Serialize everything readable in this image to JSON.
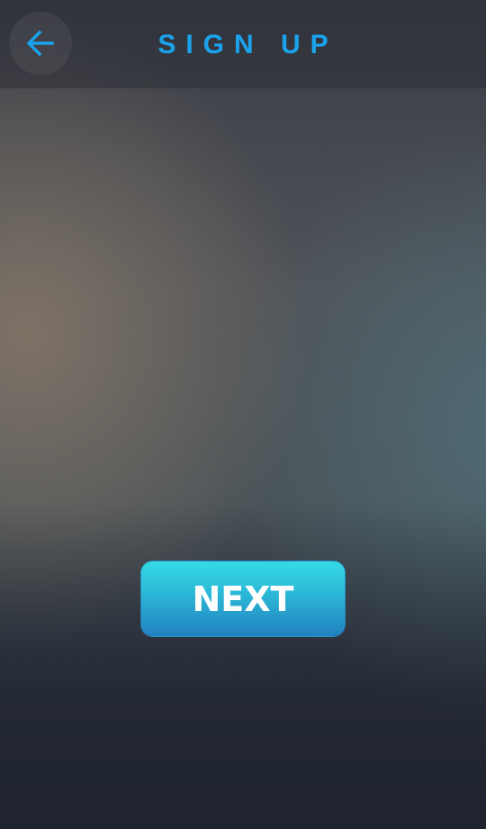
{
  "header": {
    "title": "SIGN UP",
    "back_icon": "arrow-left-icon"
  },
  "actions": {
    "next_label": "NEXT"
  },
  "colors": {
    "accent": "#1aa3ec",
    "button_top": "#36dbe6",
    "button_bottom": "#2280c0",
    "button_text": "#ffffff"
  }
}
